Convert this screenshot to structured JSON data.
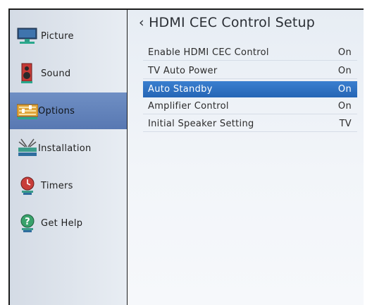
{
  "sidebar": {
    "items": [
      {
        "label": "Picture",
        "icon": "picture-monitor-icon"
      },
      {
        "label": "Sound",
        "icon": "speaker-icon"
      },
      {
        "label": "Options",
        "icon": "options-sliders-icon",
        "selected": true
      },
      {
        "label": "Installation",
        "icon": "installation-antenna-icon"
      },
      {
        "label": "Timers",
        "icon": "timer-clock-icon"
      },
      {
        "label": "Get Help",
        "icon": "help-icon"
      }
    ]
  },
  "header": {
    "back_glyph": "‹",
    "title": "HDMI CEC Control Setup"
  },
  "settings": [
    {
      "label": "Enable HDMI CEC  Control",
      "value": "On"
    },
    {
      "label": "TV Auto Power",
      "value": "On"
    },
    {
      "label": "Auto  Standby",
      "value": "On",
      "selected": true
    },
    {
      "label": "Amplifier Control",
      "value": "On"
    },
    {
      "label": "Initial Speaker Setting",
      "value": "TV"
    }
  ],
  "colors": {
    "selection_blue": "#2f73c3",
    "sidebar_selected": "#6383bb"
  }
}
